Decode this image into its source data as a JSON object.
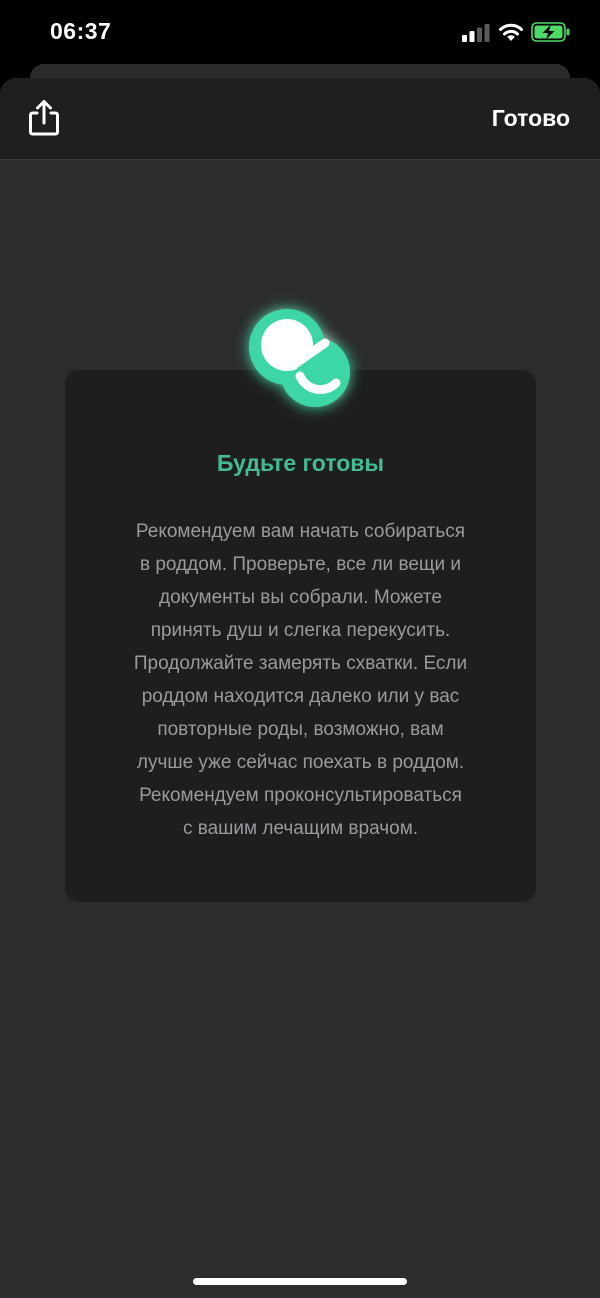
{
  "status_bar": {
    "time": "06:37",
    "icons": [
      "signal-icon",
      "wifi-icon",
      "battery-charging-icon"
    ]
  },
  "nav": {
    "share_icon": "share-icon",
    "done_label": "Готово"
  },
  "card": {
    "icon": "pacifier-icon",
    "title": "Будьте готовы",
    "body_lines": [
      "Рекомендуем вам начать собираться",
      "в роддом. Проверьте, все ли вещи и",
      "документы вы собрали. Можете",
      "принять душ и слегка перекусить.",
      "Продолжайте замерять схватки. Если",
      "роддом находится далеко или у вас",
      "повторные роды, возможно, вам",
      "лучше уже сейчас поехать в роддом.",
      "Рекомендуем проконсультироваться",
      "с вашим лечащим врачом."
    ]
  },
  "colors": {
    "accent": "#45b894",
    "battery": "#4cd964",
    "sheet_bg": "#2c2c2e",
    "card_bg": "#1e1e20"
  }
}
